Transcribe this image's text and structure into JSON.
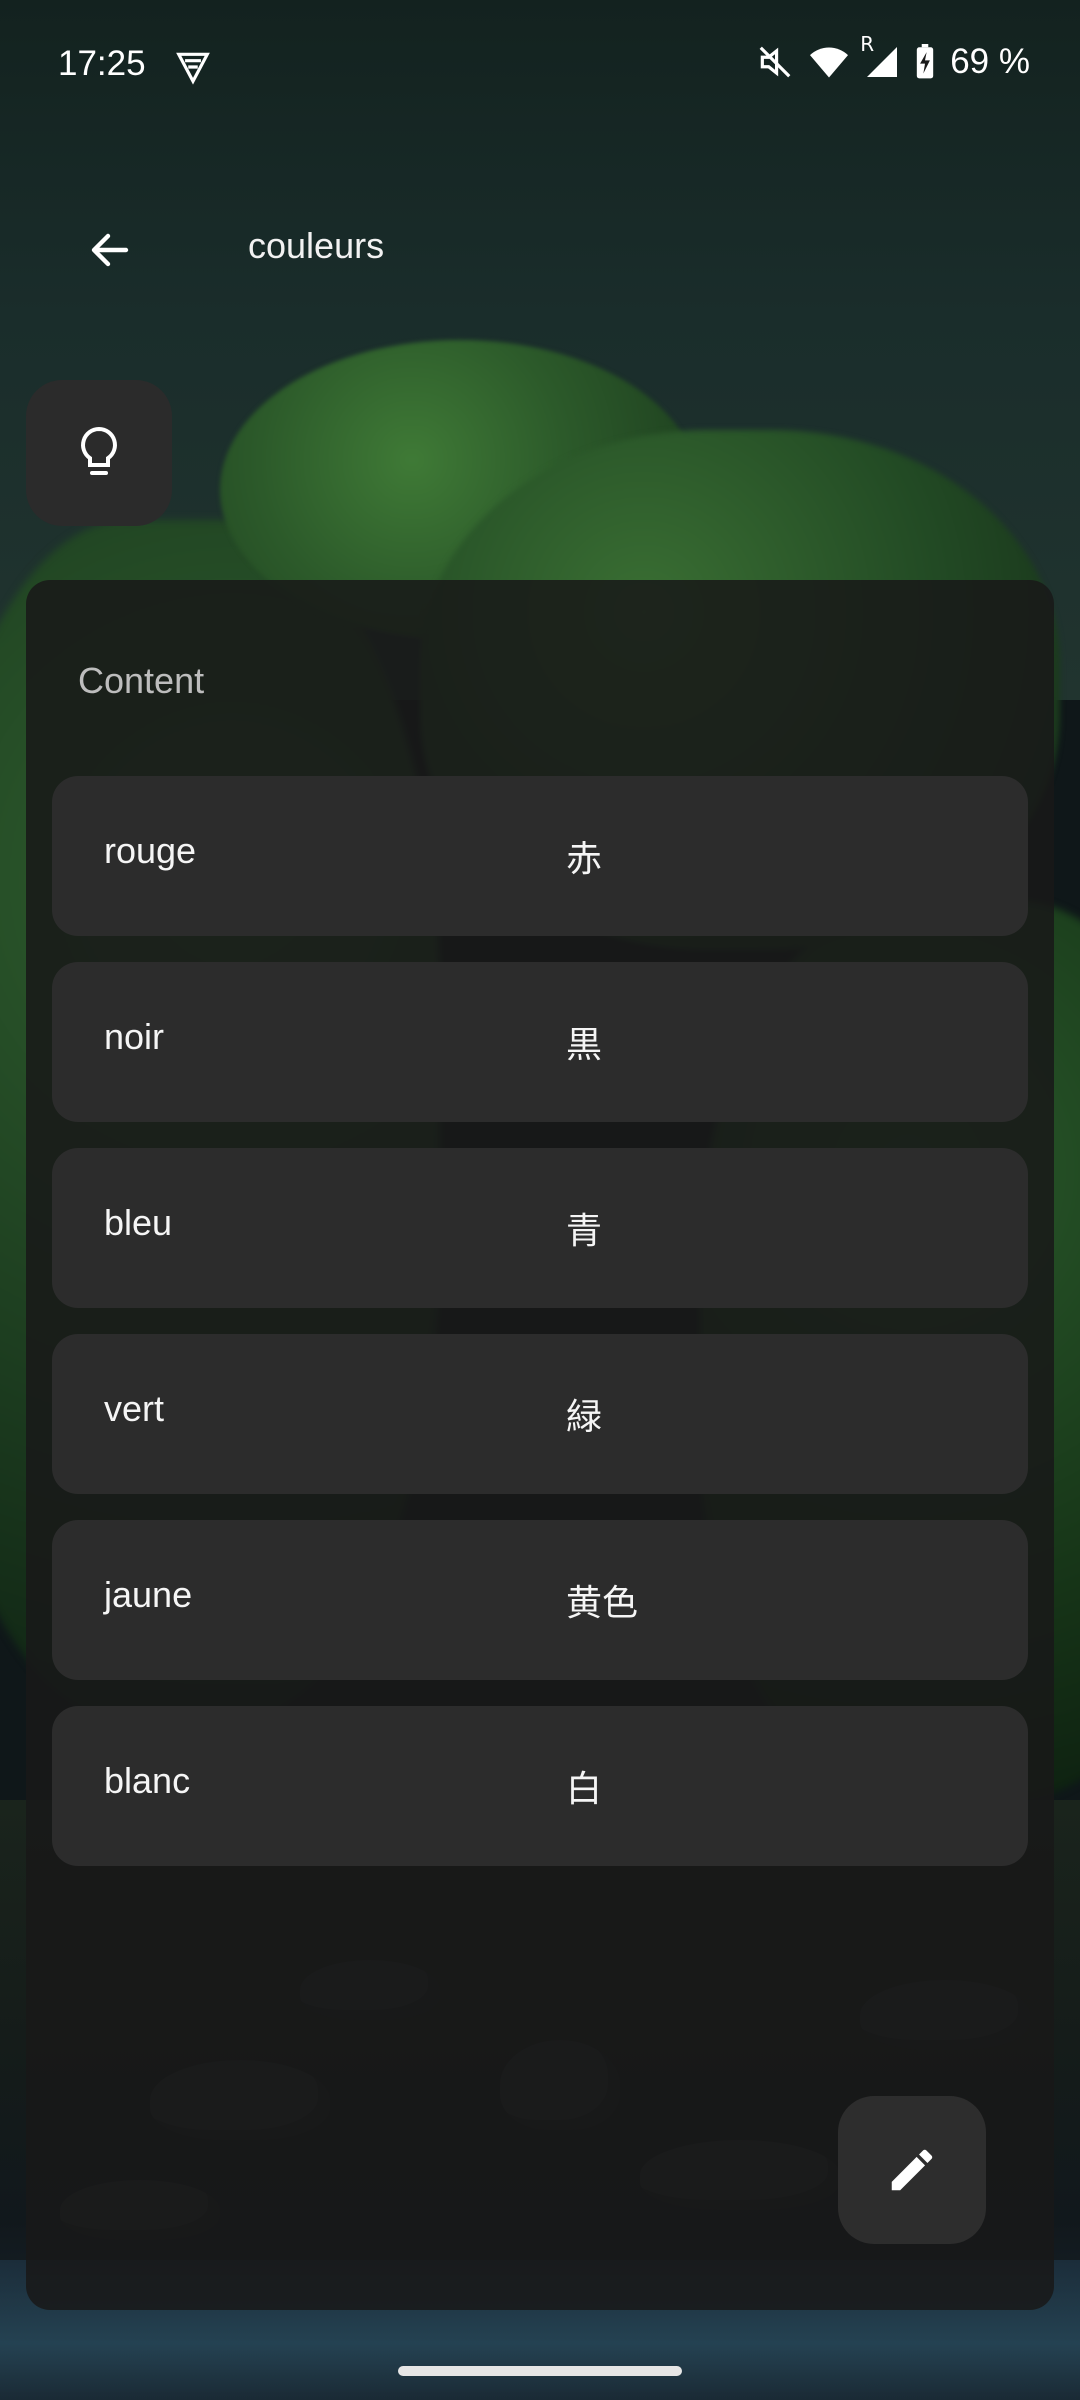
{
  "status_bar": {
    "time": "17:25",
    "battery_percent": "69 %",
    "network_label": "R",
    "icons": [
      "vpn-shield-icon",
      "mute-icon",
      "wifi-icon",
      "signal-icon",
      "battery-charging-icon"
    ]
  },
  "app_bar": {
    "title": "couleurs",
    "back_icon": "arrow-back-icon"
  },
  "hint_button": {
    "icon": "lightbulb-icon"
  },
  "content": {
    "label": "Content",
    "items": [
      {
        "term": "rouge",
        "translation": "赤"
      },
      {
        "term": "noir",
        "translation": "黒"
      },
      {
        "term": "bleu",
        "translation": "青"
      },
      {
        "term": "vert",
        "translation": "緑"
      },
      {
        "term": "jaune",
        "translation": "黄色"
      },
      {
        "term": "blanc",
        "translation": "白"
      }
    ]
  },
  "fab": {
    "icon": "edit-pencil-icon"
  },
  "colors": {
    "panel": "#181818",
    "row": "#2c2c2c",
    "button": "#2b2b2b",
    "text": "#ffffff"
  }
}
